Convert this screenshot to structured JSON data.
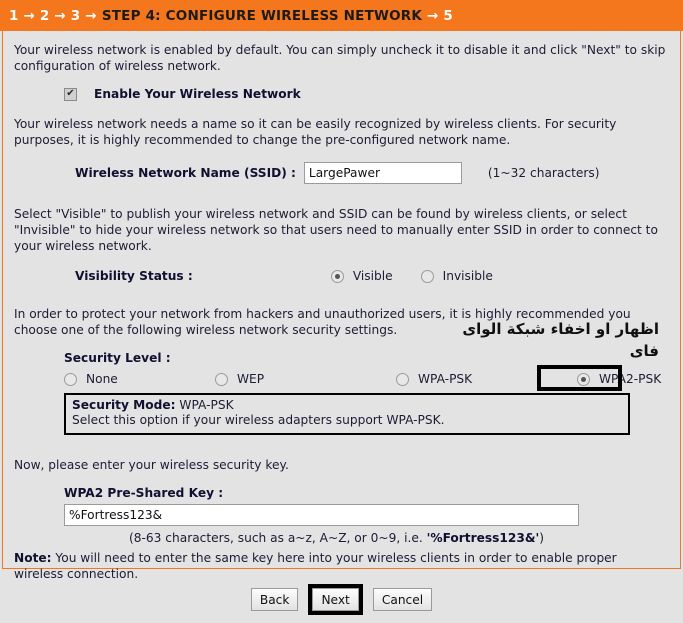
{
  "header": {
    "steps_before": "1 → 2 → 3 →",
    "current_step": "STEP 4: CONFIGURE WIRELESS NETWORK",
    "steps_after": "→ 5"
  },
  "intro": {
    "text": "Your wireless network is enabled by default. You can simply uncheck it to disable it and click \"Next\" to skip configuration of wireless network."
  },
  "enable": {
    "checkbox_glyph": "✔",
    "label": "Enable Your Wireless Network"
  },
  "ssid": {
    "description": "Your wireless network needs a name so it can be easily recognized by wireless clients. For security purposes, it is highly recommended to change the pre-configured network name.",
    "label": "Wireless Network Name (SSID) :",
    "value": "LargePawer",
    "hint": "(1~32 characters)"
  },
  "visibility": {
    "description": "Select \"Visible\" to publish your wireless network and SSID can be found by wireless clients, or select \"Invisible\" to hide your wireless network so that users need to manually enter SSID in order to connect to your wireless network.",
    "label": "Visibility Status :",
    "options": [
      {
        "label": "Visible",
        "selected": true
      },
      {
        "label": "Invisible",
        "selected": false
      }
    ],
    "annotation_line1": "اظهار او اخفاء شبكة الواى",
    "annotation_line2": "فاى"
  },
  "security": {
    "description": "In order to protect your network from hackers and unauthorized users, it is highly recommended you choose one of the following wireless network security settings.",
    "label": "Security Level :",
    "options": [
      {
        "label": "None",
        "selected": false
      },
      {
        "label": "WEP",
        "selected": false
      },
      {
        "label": "WPA-PSK",
        "selected": false
      },
      {
        "label": "WPA2-PSK",
        "selected": true
      }
    ],
    "mode_label": "Security Mode:",
    "mode_value": "WPA-PSK",
    "mode_description": "Select this option if your wireless adapters support WPA-PSK."
  },
  "key": {
    "intro": "Now, please enter your wireless security key.",
    "label": "WPA2 Pre-Shared Key :",
    "value": "%Fortress123&",
    "hint_prefix": "(8-63 characters, such as a~z, A~Z, or 0~9, i.e. ",
    "hint_example": "'%Fortress123&'",
    "hint_suffix": ")",
    "note_label": "Note:",
    "note_text": " You will need to enter the same key here into your wireless clients in order to enable proper wireless connection."
  },
  "footer": {
    "back": "Back",
    "next": "Next",
    "cancel": "Cancel"
  },
  "colors": {
    "accent": "#f4761d",
    "background": "#e3e3e3",
    "text": "#1c1c36"
  }
}
